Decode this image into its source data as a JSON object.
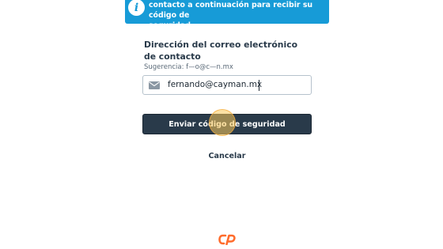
{
  "info_banner": {
    "icon": "info-icon",
    "text": "contacto a continuación para recibir su código de\nseguridad."
  },
  "email_section": {
    "label": "Dirección del correo electrónico de contacto",
    "hint": "Sugerencia: f—o@c—n.mx",
    "input_icon": "envelope-icon",
    "input_value": "fernando@cayman.mx"
  },
  "actions": {
    "submit_label": "Enviar código de seguridad",
    "cancel_label": "Cancelar"
  },
  "brand": {
    "logo": "cpanel-logo",
    "accent_color": "#ff6c2c",
    "banner_color": "#179bd7",
    "button_color": "#293a4a"
  }
}
